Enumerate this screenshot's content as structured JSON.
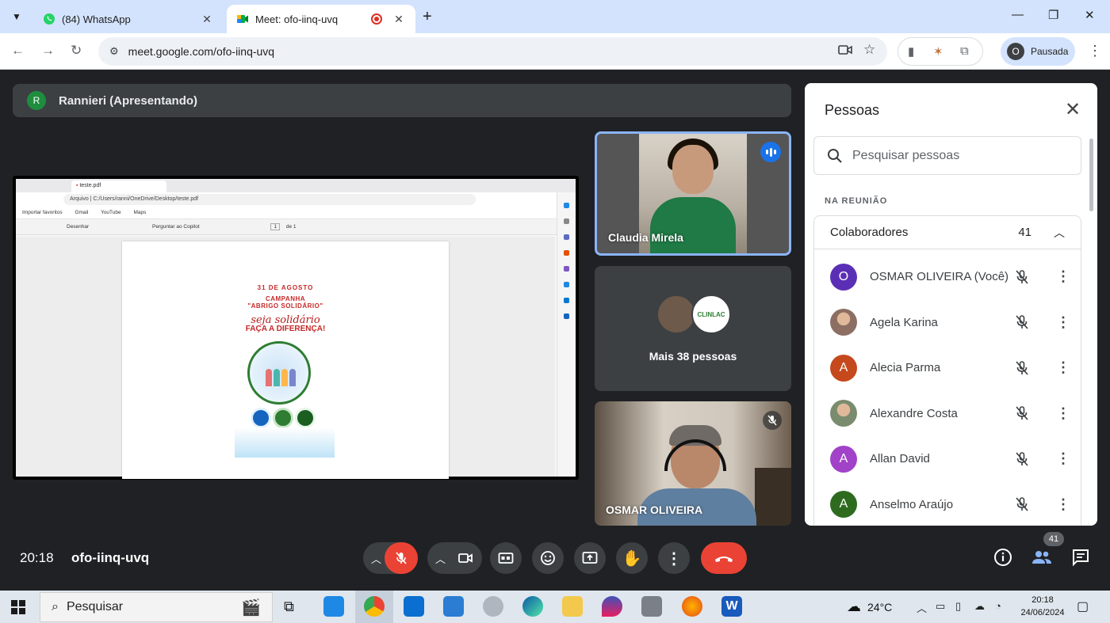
{
  "browser": {
    "tabs": [
      {
        "title": "(84) WhatsApp",
        "active": false
      },
      {
        "title": "Meet: ofo-iinq-uvq",
        "active": true
      }
    ],
    "url": "meet.google.com/ofo-iinq-uvq",
    "profile": {
      "initial": "O",
      "status": "Pausada"
    }
  },
  "meet": {
    "presenter": {
      "initial": "R",
      "label": "Rannieri (Apresentando)"
    },
    "shared_screen": {
      "tab_title": "teste.pdf",
      "address": "Arquivo | C:/Users/ranni/OneDrive/Desktop/teste.pdf",
      "favorites": [
        "Importar favoritos",
        "Gmail",
        "YouTube",
        "Maps"
      ],
      "pdf_tools": [
        "Desenhar",
        "Perguntar ao Copilot",
        "1",
        "de 1"
      ],
      "pdf": {
        "date": "31 DE AGOSTO",
        "campaign_1": "CAMPANHA",
        "campaign_2": "\"ABRIGO SOLIDÁRIO\"",
        "tagline": "seja solidário",
        "cta": "FAÇA A DIFERENÇA!"
      }
    },
    "tiles": [
      {
        "name": "Claudia Mirela",
        "speaking": true
      },
      {
        "name": "Mais 38 pessoas",
        "logo_text": "CLINLAC"
      },
      {
        "name": "OSMAR OLIVEIRA",
        "muted": true
      }
    ],
    "time": "20:18",
    "meeting_code": "ofo-iinq-uvq",
    "participant_count": "41"
  },
  "people_panel": {
    "title": "Pessoas",
    "search_placeholder": "Pesquisar pessoas",
    "section": "NA REUNIÃO",
    "group_label": "Colaboradores",
    "group_count": "41",
    "participants": [
      {
        "initial": "O",
        "name": "OSMAR OLIVEIRA (Você)",
        "color": "#5b2fb5",
        "photo": false
      },
      {
        "initial": "",
        "name": "Agela Karina",
        "color": "#8d6e63",
        "photo": true
      },
      {
        "initial": "A",
        "name": "Alecia Parma",
        "color": "#c5491c",
        "photo": false
      },
      {
        "initial": "",
        "name": "Alexandre Costa",
        "color": "#7a8c6e",
        "photo": true
      },
      {
        "initial": "A",
        "name": "Allan David",
        "color": "#a142c9",
        "photo": false
      },
      {
        "initial": "A",
        "name": "Anselmo Araújo",
        "color": "#2e6b1f",
        "photo": false
      }
    ]
  },
  "taskbar": {
    "search_label": "Pesquisar",
    "temperature": "24°C",
    "clock_time": "20:18",
    "clock_date": "24/06/2024"
  },
  "colors": {
    "meet_bg": "#202124",
    "hangup_red": "#ea4335",
    "speaking_blue": "#1a73e8",
    "active_tile_border": "#8ab4f8"
  }
}
